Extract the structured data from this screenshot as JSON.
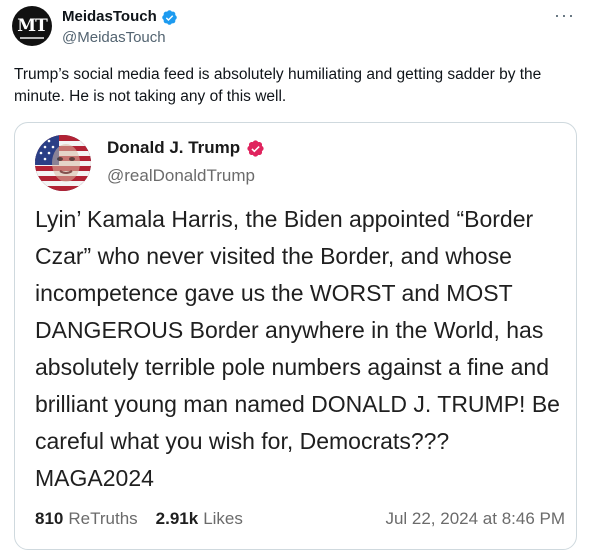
{
  "tweet": {
    "author_name": "MeidasTouch",
    "author_handle": "@MeidasTouch",
    "avatar_text": "MT",
    "more_label": "···",
    "text": "Trump’s social media feed is absolutely humiliating and getting sadder by the minute. He is not taking any of this well.",
    "verified_color": "#1d9bf0"
  },
  "quoted_post": {
    "author_name": "Donald J. Trump",
    "author_handle": "@realDonaldTrump",
    "verified_color": "#e0245e",
    "text": "Lyin’ Kamala Harris, the Biden appointed “Border Czar” who never visited the Border, and whose incompetence gave us the WORST and MOST DANGEROUS Border anywhere in the World, has absolutely terrible pole numbers against a fine and brilliant young man named DONALD J. TRUMP! Be careful what you wish for, Democrats???  MAGA2024",
    "retruths_count": "810",
    "retruths_label": "ReTruths",
    "likes_count": "2.91k",
    "likes_label": "Likes",
    "timestamp": "Jul 22, 2024 at 8:46 PM"
  }
}
